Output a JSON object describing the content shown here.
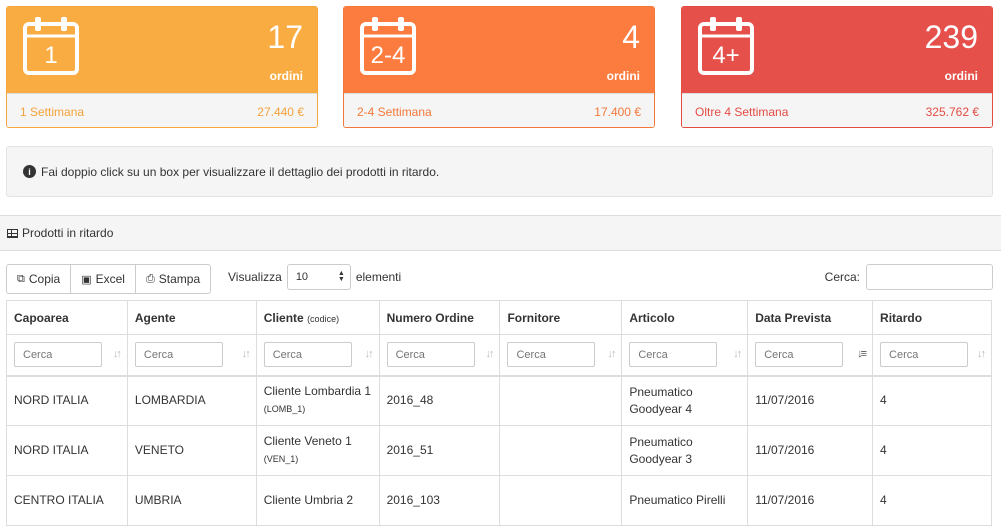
{
  "boxes": [
    {
      "cal": "1",
      "count": "17",
      "unit": "ordini",
      "label": "1 Settimana",
      "amount": "27.440 €",
      "color": "#f9ac42"
    },
    {
      "cal": "2-4",
      "count": "4",
      "unit": "ordini",
      "label": "2-4 Settimana",
      "amount": "17.400 €",
      "color": "#fc7b3f"
    },
    {
      "cal": "4+",
      "count": "239",
      "unit": "ordini",
      "label": "Oltre 4 Settimana",
      "amount": "325.762 €",
      "color": "#e5504b"
    }
  ],
  "info_text": "Fai doppio click su un box per visualizzare il dettaglio dei prodotti in ritardo.",
  "panel_title": "Prodotti in ritardo",
  "toolbar": {
    "copy": "Copia",
    "excel": "Excel",
    "print": "Stampa"
  },
  "length": {
    "prefix": "Visualizza",
    "value": "10",
    "suffix": "elementi"
  },
  "search_label": "Cerca:",
  "filter_placeholder": "Cerca",
  "columns": [
    "Capoarea",
    "Agente",
    "Cliente",
    "Numero Ordine",
    "Fornitore",
    "Articolo",
    "Data Prevista",
    "Ritardo"
  ],
  "cliente_suffix": "(codice)",
  "rows": [
    {
      "capoarea": "NORD ITALIA",
      "agente": "LOMBARDIA",
      "cliente": "Cliente Lombardia 1",
      "codice": "(LOMB_1)",
      "ordine": "2016_48",
      "fornitore": "",
      "articolo": "Pneumatico Goodyear 4",
      "data": "11/07/2016",
      "ritardo": "4"
    },
    {
      "capoarea": "NORD ITALIA",
      "agente": "VENETO",
      "cliente": "Cliente Veneto 1",
      "codice": "(VEN_1)",
      "ordine": "2016_51",
      "fornitore": "",
      "articolo": "Pneumatico Goodyear 3",
      "data": "11/07/2016",
      "ritardo": "4"
    },
    {
      "capoarea": "CENTRO ITALIA",
      "agente": "UMBRIA",
      "cliente": "Cliente Umbria 2",
      "codice": "",
      "ordine": "2016_103",
      "fornitore": "",
      "articolo": "Pneumatico Pirelli",
      "data": "11/07/2016",
      "ritardo": "4"
    }
  ]
}
